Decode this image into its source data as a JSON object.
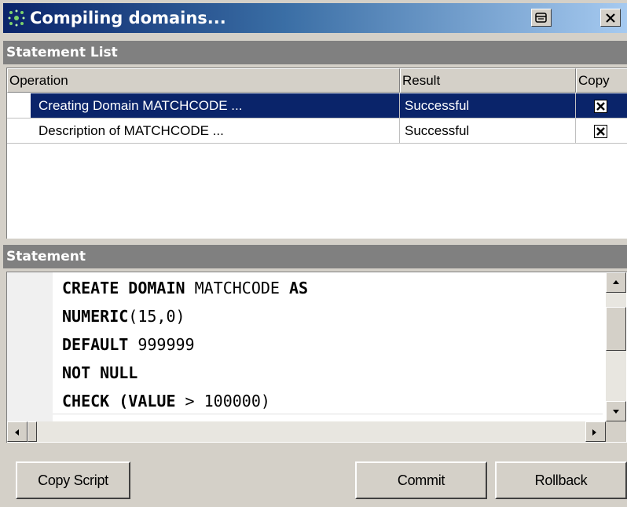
{
  "window": {
    "title": "Compiling domains...",
    "icons": {
      "app": "network-nodes-icon",
      "pin": "pin-icon",
      "close": "close-icon"
    }
  },
  "statement_list": {
    "header": "Statement List",
    "columns": [
      "Operation",
      "Result",
      "Copy"
    ],
    "rows": [
      {
        "operation": "Creating Domain MATCHCODE ...",
        "result": "Successful",
        "copy": true,
        "selected": true
      },
      {
        "operation": "Description of MATCHCODE ...",
        "result": "Successful",
        "copy": true,
        "selected": false
      }
    ]
  },
  "statement": {
    "header": "Statement",
    "lines": [
      [
        {
          "t": "CREATE DOMAIN ",
          "kw": true
        },
        {
          "t": "MATCHCODE ",
          "kw": false
        },
        {
          "t": "AS",
          "kw": true
        }
      ],
      [
        {
          "t": "NUMERIC",
          "kw": true
        },
        {
          "t": "(15,0)",
          "kw": false
        }
      ],
      [
        {
          "t": "DEFAULT ",
          "kw": true
        },
        {
          "t": "999999",
          "kw": false
        }
      ],
      [
        {
          "t": "NOT NULL",
          "kw": true
        }
      ],
      [
        {
          "t": "CHECK (VALUE ",
          "kw": true
        },
        {
          "t": "> 100000)",
          "kw": false
        }
      ]
    ]
  },
  "buttons": {
    "copy_script": "Copy Script",
    "commit": "Commit",
    "rollback": "Rollback"
  },
  "colors": {
    "selection": "#0a246a",
    "titlebar_start": "#0a246a",
    "titlebar_end": "#a6caf0",
    "panel": "#d4d0c8",
    "section_header": "#808080"
  }
}
